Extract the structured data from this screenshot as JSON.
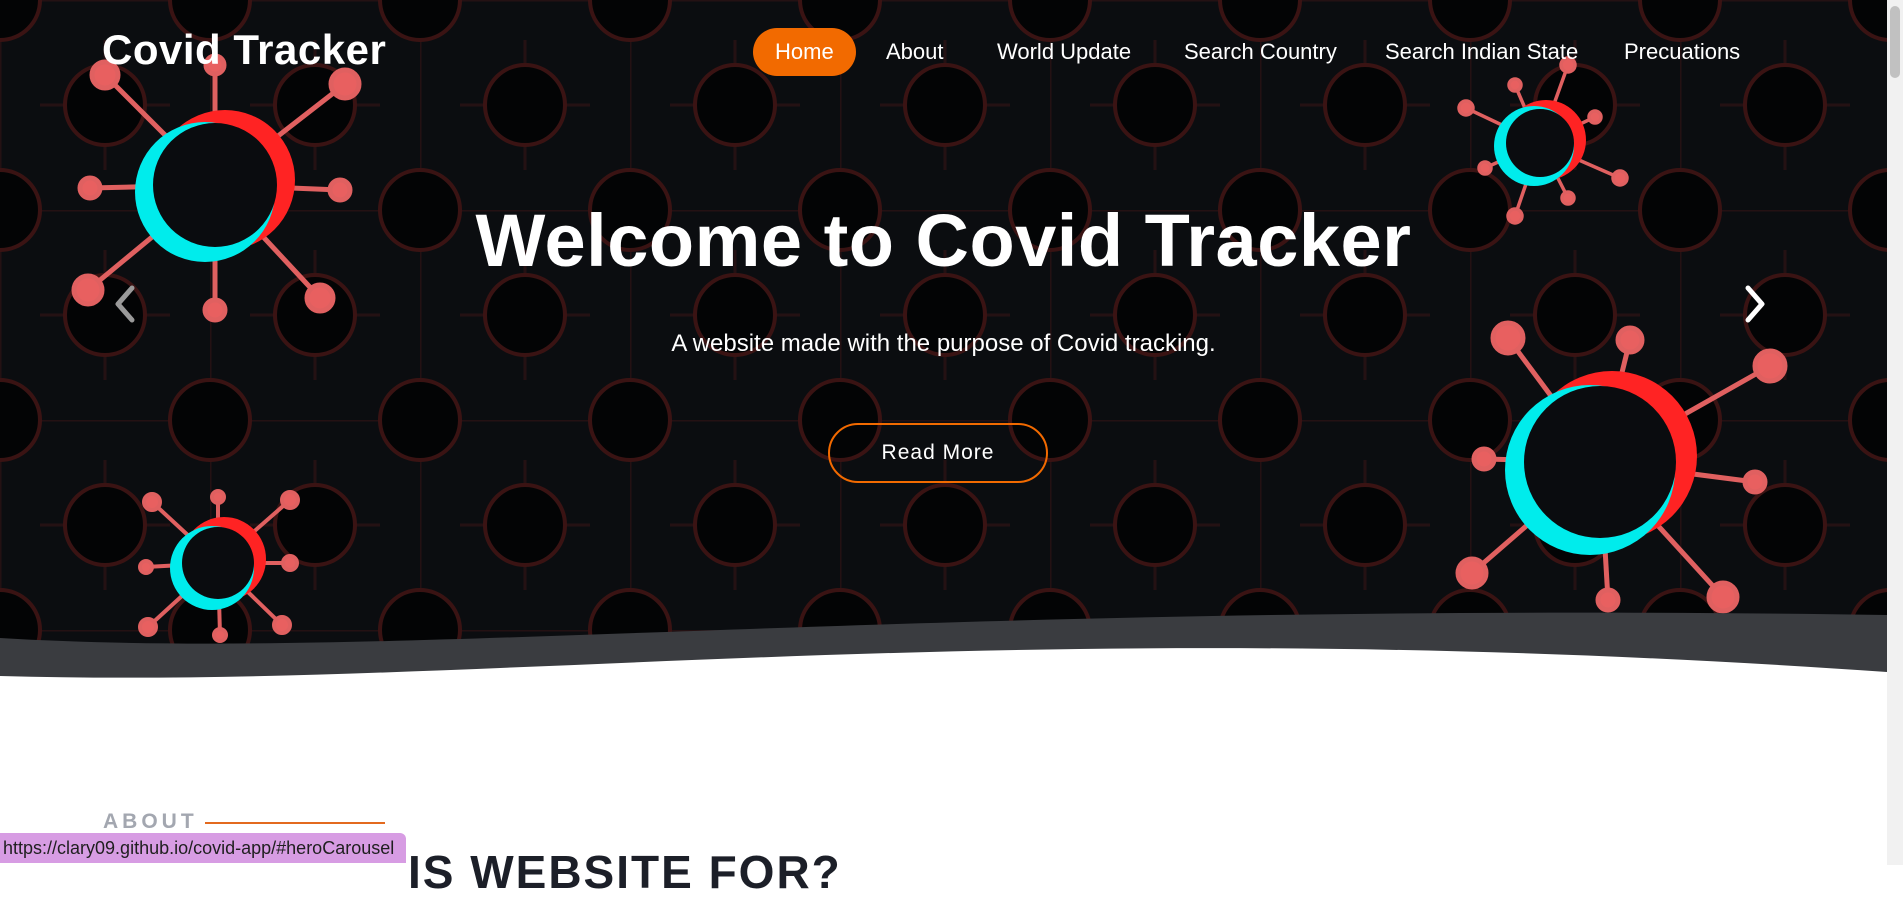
{
  "brand": "Covid Tracker",
  "nav": {
    "active": "Home",
    "items": [
      "Home",
      "About",
      "World Update",
      "Search Country",
      "Search Indian State",
      "Precuations"
    ]
  },
  "hero": {
    "title": "Welcome to Covid Tracker",
    "subtitle": "A website made with the purpose of Covid tracking.",
    "button": "Read More"
  },
  "about": {
    "label": "ABOUT",
    "heading": "IS WEBSITE FOR?"
  },
  "status_url": "https://clary09.github.io/covid-app/#heroCarousel",
  "colors": {
    "accent": "#f26a00",
    "hero_background": "#0b0d10",
    "virus_red": "#ff2b2b",
    "virus_cyan": "#00f0f0"
  },
  "icons": {
    "prev": "chevron-left-icon",
    "next": "chevron-right-icon"
  }
}
